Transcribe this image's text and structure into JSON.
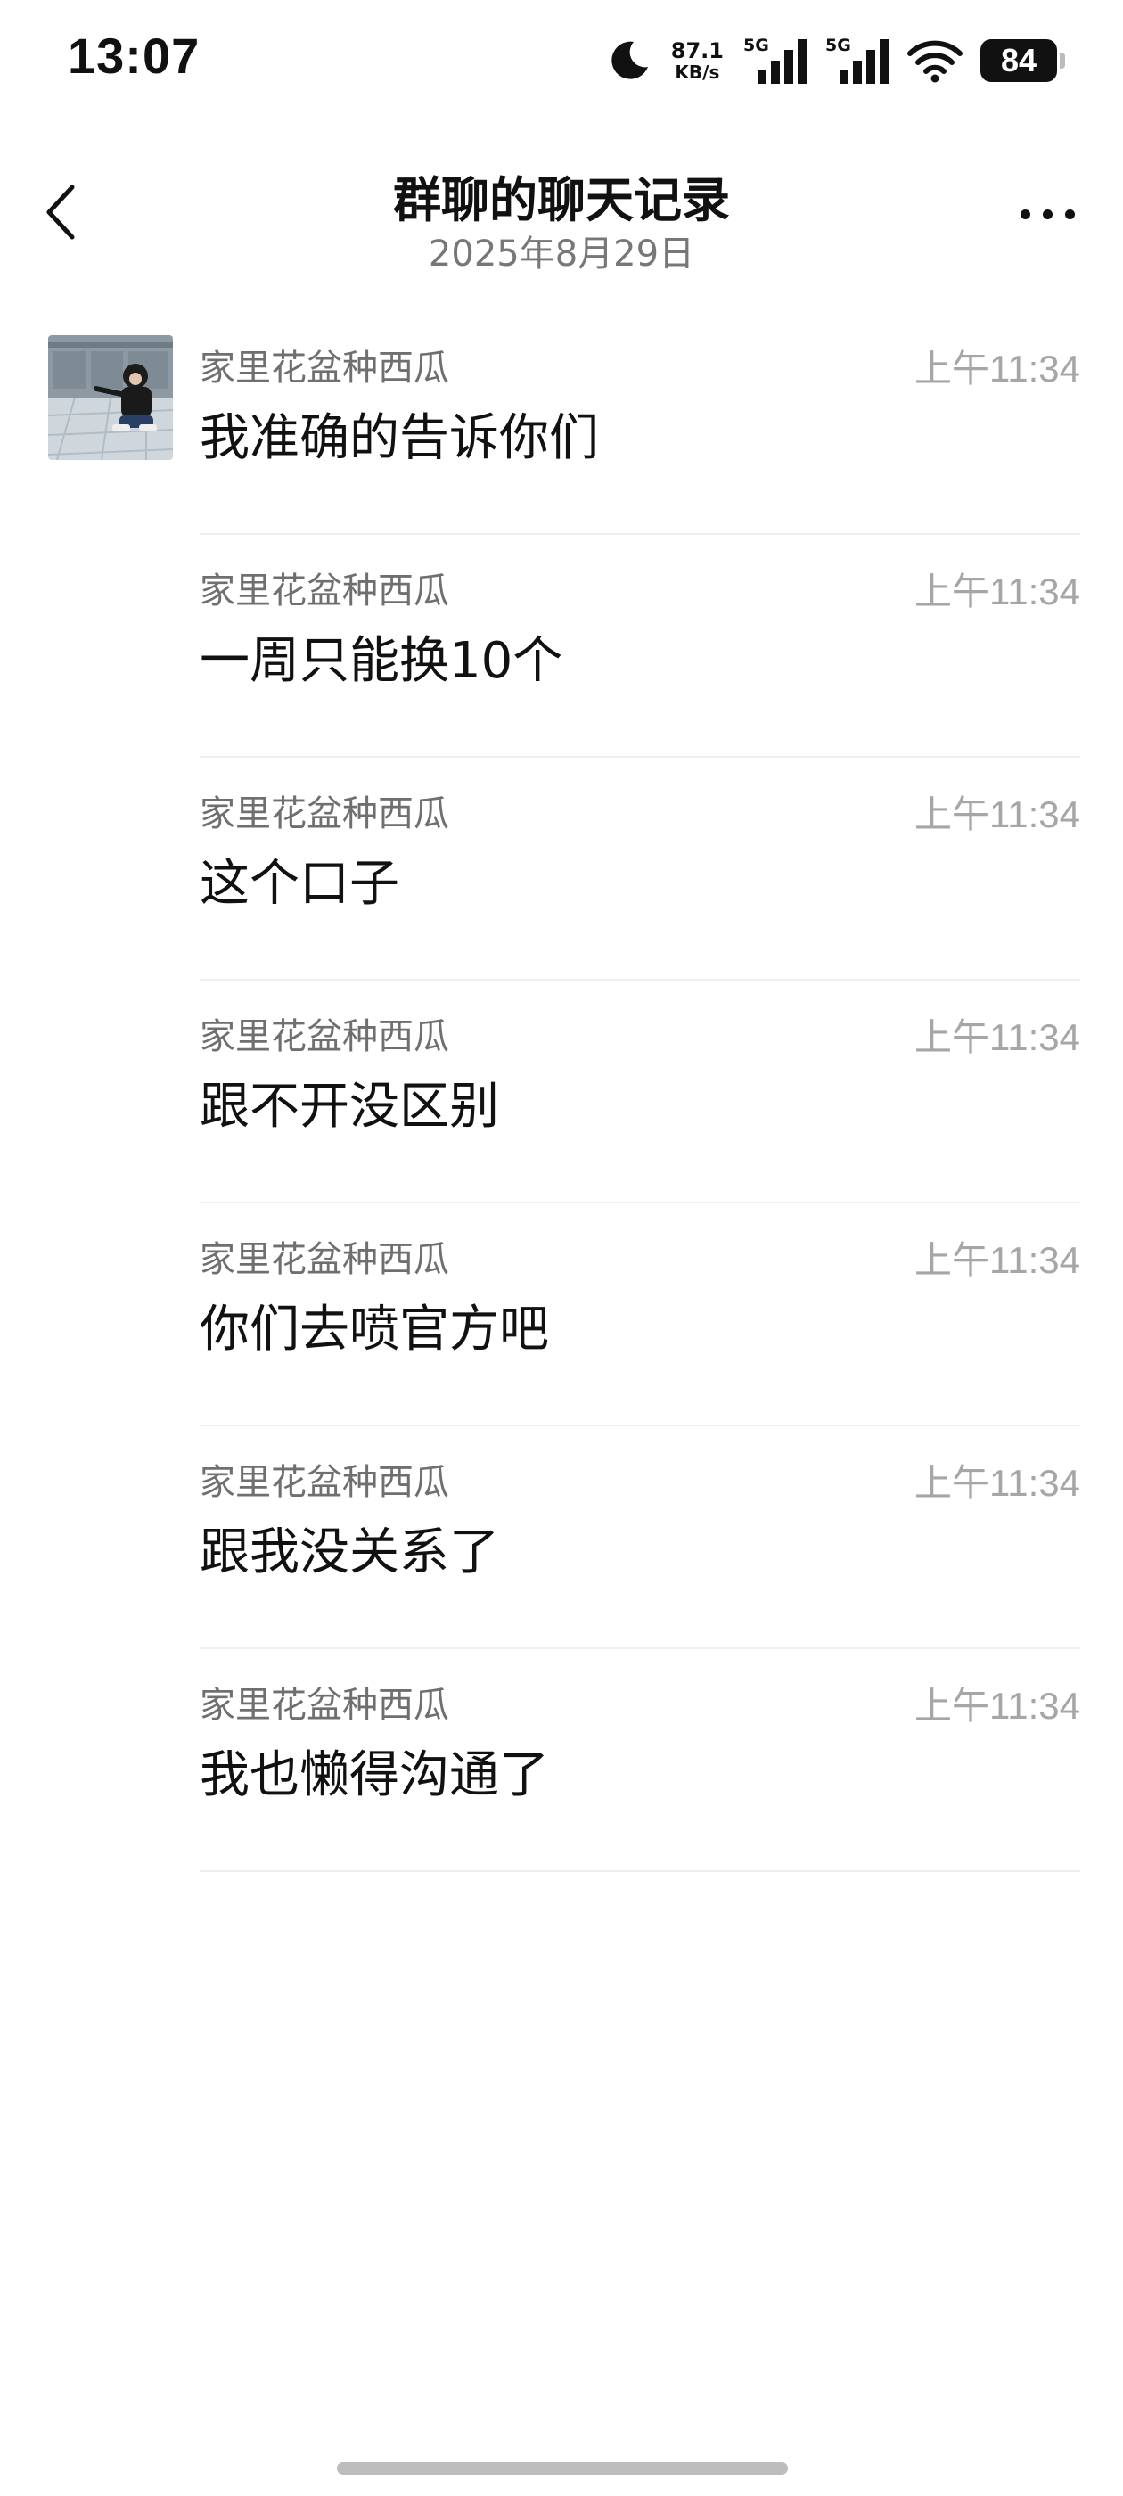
{
  "status_bar": {
    "time": "13:07",
    "net_speed_value": "87.1",
    "net_speed_unit": "KB/s",
    "sim1_label": "5G",
    "sim2_label": "5G",
    "battery": "84",
    "icons": [
      "moon-icon",
      "cellular-signal-icon",
      "cellular-signal-icon",
      "wifi-icon",
      "battery-icon"
    ]
  },
  "header": {
    "title": "群聊的聊天记录",
    "subtitle": "2025年8月29日",
    "back_icon": "chevron-left-icon",
    "more_icon": "more-icon"
  },
  "messages": [
    {
      "sender": "家里花盆种西瓜",
      "time": "上午11:34",
      "text": "我准确的告诉你们",
      "show_avatar": true
    },
    {
      "sender": "家里花盆种西瓜",
      "time": "上午11:34",
      "text": "一周只能换10个",
      "show_avatar": false
    },
    {
      "sender": "家里花盆种西瓜",
      "time": "上午11:34",
      "text": "这个口子",
      "show_avatar": false
    },
    {
      "sender": "家里花盆种西瓜",
      "time": "上午11:34",
      "text": "跟不开没区别",
      "show_avatar": false
    },
    {
      "sender": "家里花盆种西瓜",
      "time": "上午11:34",
      "text": "你们去喷官方吧",
      "show_avatar": false
    },
    {
      "sender": "家里花盆种西瓜",
      "time": "上午11:34",
      "text": "跟我没关系了",
      "show_avatar": false
    },
    {
      "sender": "家里花盆种西瓜",
      "time": "上午11:34",
      "text": "我也懒得沟通了",
      "show_avatar": false
    }
  ]
}
